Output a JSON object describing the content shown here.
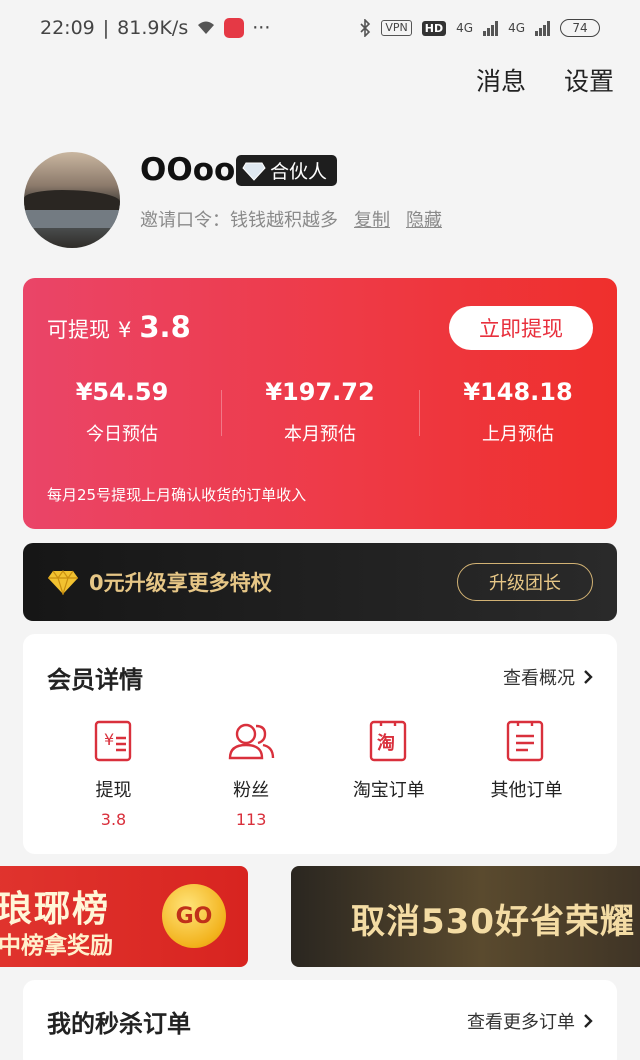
{
  "status_bar": {
    "time": "22:09",
    "speed": "81.9K/s",
    "more": "···",
    "vpn": "VPN",
    "hd": "HD",
    "net1": "4G",
    "net2": "4G",
    "battery": "74"
  },
  "topnav": {
    "messages": "消息",
    "settings": "设置"
  },
  "profile": {
    "username": "OOoo",
    "tag": "合伙人",
    "invite_label": "邀请口令：",
    "invite_code": "钱钱越积越多",
    "copy": "复制",
    "hide": "隐藏"
  },
  "earnings": {
    "available_label": "可提现",
    "currency": "¥",
    "available_amount": "3.8",
    "withdraw_button": "立即提现",
    "stats": [
      {
        "value": "¥54.59",
        "label": "今日预估"
      },
      {
        "value": "¥197.72",
        "label": "本月预估"
      },
      {
        "value": "¥148.18",
        "label": "上月预估"
      }
    ],
    "note": "每月25号提现上月确认收货的订单收入"
  },
  "upgrade": {
    "text": "0元升级享更多特权",
    "button": "升级团长"
  },
  "member": {
    "title": "会员详情",
    "more": "查看概况",
    "items": [
      {
        "name": "提现",
        "num": "3.8",
        "icon": "withdraw-icon"
      },
      {
        "name": "粉丝",
        "num": "113",
        "icon": "fans-icon"
      },
      {
        "name": "淘宝订单",
        "num": "",
        "icon": "taobao-order-icon"
      },
      {
        "name": "其他订单",
        "num": "",
        "icon": "other-order-icon"
      }
    ]
  },
  "banners": {
    "b1_title": "琅琊榜",
    "b1_sub": "中榜拿奖励",
    "b1_go": "GO",
    "b2_title": "取消530好省荣耀"
  },
  "seckill": {
    "title": "我的秒杀订单",
    "more": "查看更多订单"
  },
  "colors": {
    "accent": "#ee3a46",
    "gold": "#e6c686",
    "red_text": "#d9303c"
  }
}
